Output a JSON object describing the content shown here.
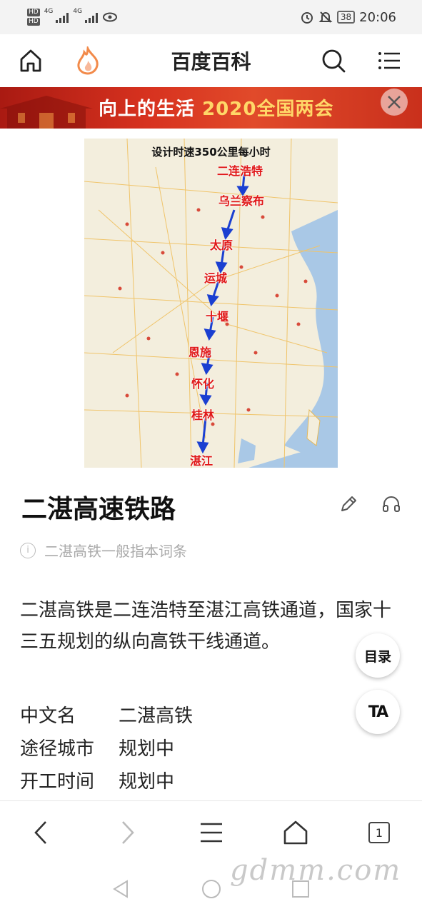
{
  "status_bar": {
    "hd1": "HD",
    "hd2": "HD",
    "net1": "4G",
    "net2": "4G",
    "battery": "38",
    "time": "20:06"
  },
  "nav": {
    "title": "百度百科"
  },
  "banner": {
    "text": "向上的生活",
    "year_text": "2020全国两会"
  },
  "map": {
    "caption": "设计时速350公里每小时",
    "cities": [
      "二连浩特",
      "乌兰察布",
      "太原",
      "运城",
      "十堰",
      "恩施",
      "怀化",
      "桂林",
      "湛江"
    ]
  },
  "article": {
    "title": "二湛高速铁路",
    "disambiguation": "二湛高铁一般指本词条",
    "summary": "二湛高铁是二连浩特至湛江高铁通道，国家十三五规划的纵向高铁干线通道。",
    "info": [
      {
        "key": "中文名",
        "value": "二湛高铁"
      },
      {
        "key": "途径城市",
        "value": "规划中"
      },
      {
        "key": "开工时间",
        "value": "规划中"
      }
    ]
  },
  "fabs": {
    "toc": "目录",
    "ta": "TA"
  },
  "browser_bar": {
    "tab_count": "1"
  },
  "watermark": "gdmm.com",
  "colors": {
    "banner_red": "#d7321f",
    "accent_orange": "#f28a4a",
    "city_red": "#e01818",
    "route_blue": "#1a3fd1"
  }
}
